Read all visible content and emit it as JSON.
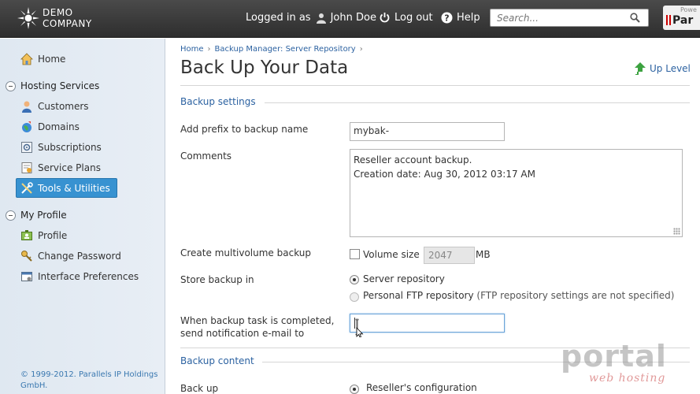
{
  "header": {
    "logo_line1": "DEMO",
    "logo_line2": "COMPANY",
    "logged_in_prefix": "Logged in as",
    "user_name": "John Doe",
    "logout_label": "Log out",
    "help_label": "Help",
    "search_placeholder": "Search...",
    "powered_label": "Powe",
    "powered_brand": "Par"
  },
  "sidebar": {
    "home": "Home",
    "hosting_group": "Hosting Services",
    "hosting_items": [
      "Customers",
      "Domains",
      "Subscriptions",
      "Service Plans",
      "Tools & Utilities"
    ],
    "profile_group": "My Profile",
    "profile_items": [
      "Profile",
      "Change Password",
      "Interface Preferences"
    ],
    "copyright": "© 1999-2012. Parallels IP Holdings GmbH."
  },
  "breadcrumb": [
    "Home",
    "Backup Manager: Server Repository"
  ],
  "page_title": "Back Up Your Data",
  "up_level": "Up Level",
  "settings": {
    "section_title": "Backup settings",
    "prefix_label": "Add prefix to backup name",
    "prefix_value": "mybak-",
    "comments_label": "Comments",
    "comments_line1": "Reseller account  backup.",
    "comments_line2": "Creation date: Aug 30, 2012 03:17 AM",
    "multivolume_label": "Create multivolume backup",
    "volume_size_label": "Volume size",
    "volume_size_value": "2047",
    "volume_unit": "MB",
    "store_label": "Store backup in",
    "store_option1": "Server repository",
    "store_option2": "Personal FTP repository",
    "store_option2_note": "(FTP repository settings are not specified)",
    "notify_label_line1": "When backup task is completed,",
    "notify_label_line2": "send notification e-mail to"
  },
  "content": {
    "section_title": "Backup content",
    "backup_label": "Back up",
    "backup_option1": "Reseller's configuration"
  },
  "watermark": {
    "big": "portal",
    "small": "web hosting"
  },
  "colors": {
    "accent": "#2c62a1",
    "active_item": "#3792d1",
    "header_bg": "#3a3a3a"
  }
}
